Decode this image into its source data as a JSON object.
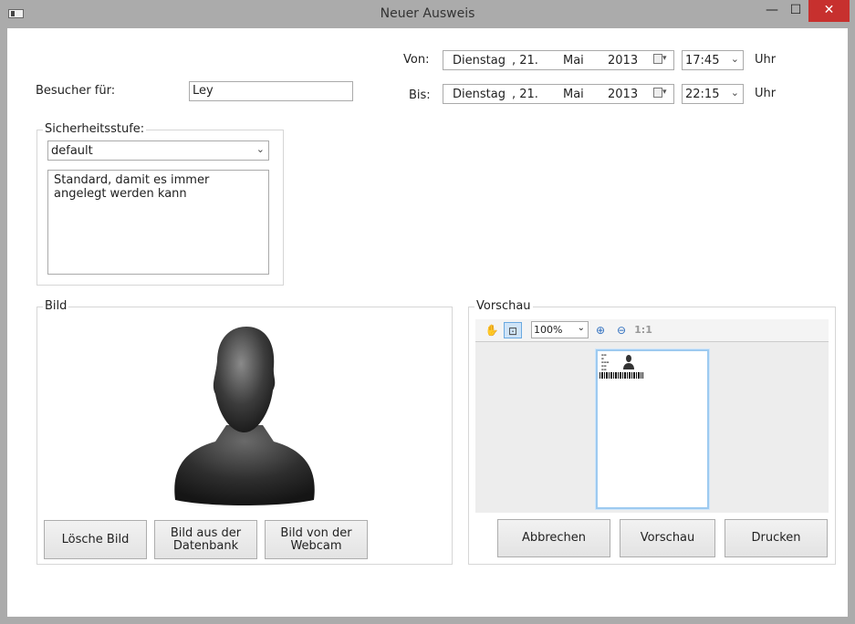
{
  "window": {
    "title": "Neuer Ausweis",
    "controls": {
      "minimize": "—",
      "maximize": "☐",
      "close": "✕"
    }
  },
  "visitor": {
    "label": "Besucher für:",
    "value": "Ley"
  },
  "from": {
    "label": "Von:",
    "weekday": "Dienstag",
    "day": ", 21.",
    "month": "Mai",
    "year": "2013",
    "time": "17:45",
    "unit": "Uhr"
  },
  "to": {
    "label": "Bis:",
    "weekday": "Dienstag",
    "day": ", 21.",
    "month": "Mai",
    "year": "2013",
    "time": "22:15",
    "unit": "Uhr"
  },
  "security": {
    "group_title": "Sicherheitsstufe:",
    "selected": "default",
    "description": "Standard, damit es immer angelegt werden kann"
  },
  "image": {
    "group_title": "Bild",
    "buttons": {
      "delete": "Lösche Bild",
      "from_db": "Bild aus der Datenbank",
      "from_webcam": "Bild von der Webcam"
    }
  },
  "preview": {
    "group_title": "Vorschau",
    "zoom": "100%",
    "actual_size": "1:1",
    "buttons": {
      "cancel": "Abbrechen",
      "preview": "Vorschau",
      "print": "Drucken"
    }
  }
}
